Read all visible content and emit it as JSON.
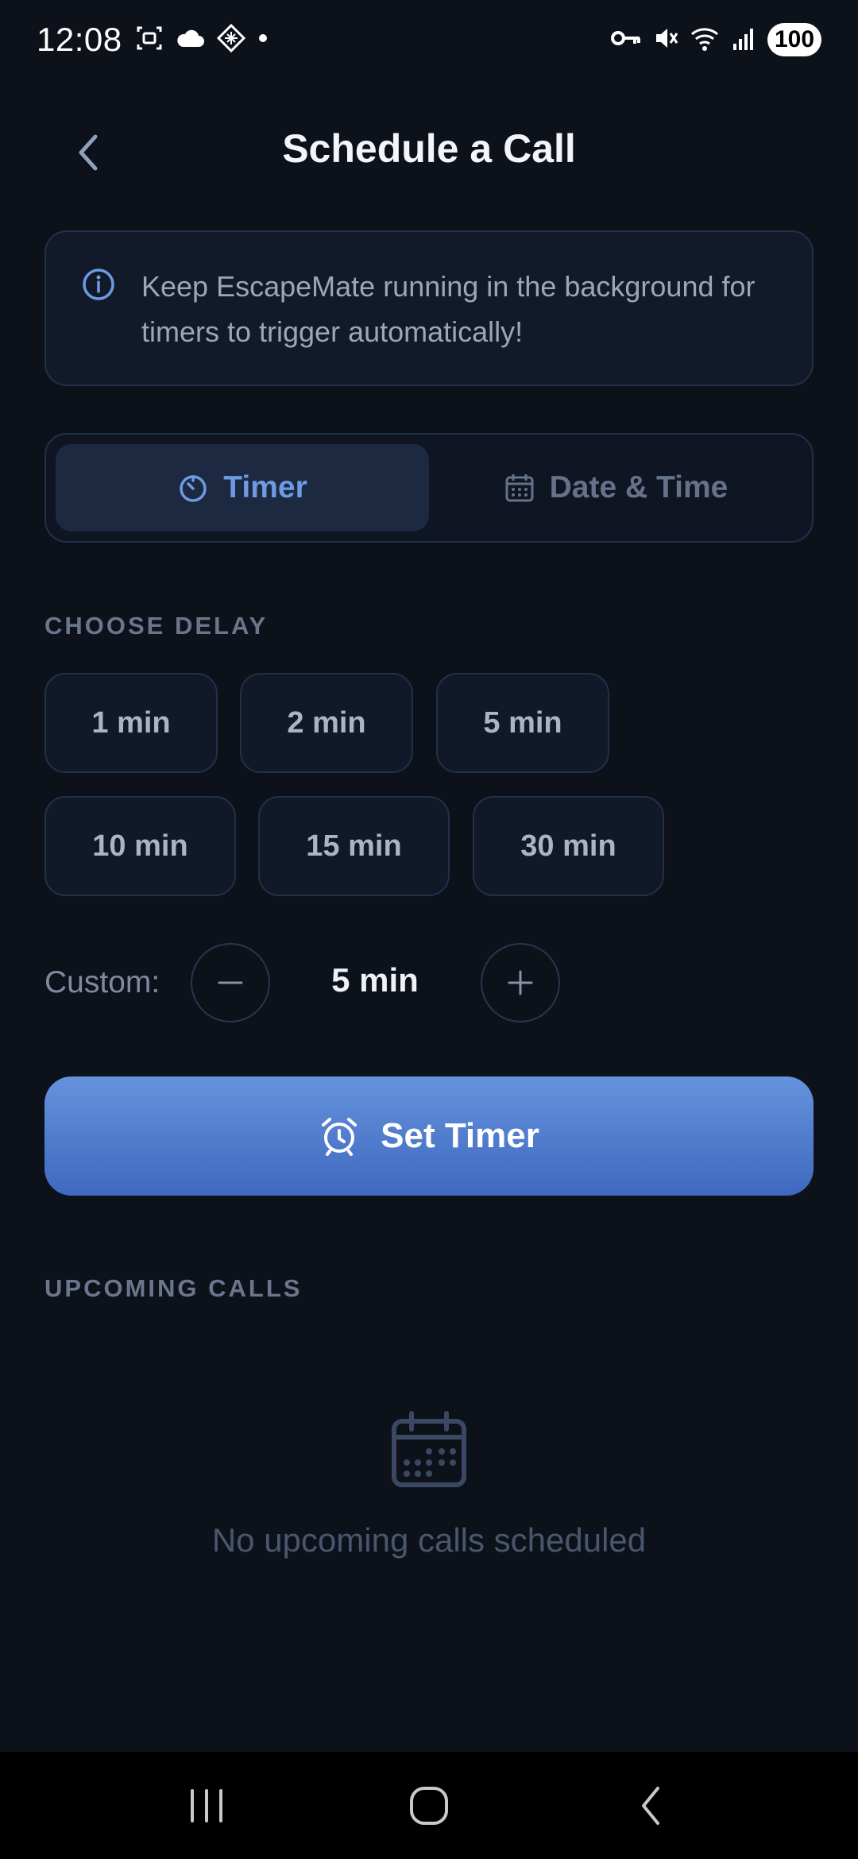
{
  "status_bar": {
    "time": "12:08",
    "battery": "100"
  },
  "header": {
    "title": "Schedule a Call"
  },
  "info": {
    "text": "Keep EscapeMate running in the background for timers to trigger automatically!"
  },
  "tabs": [
    {
      "label": "Timer",
      "icon": "timer-icon",
      "active": true
    },
    {
      "label": "Date & Time",
      "icon": "calendar-icon",
      "active": false
    }
  ],
  "choose_delay": {
    "label": "CHOOSE DELAY",
    "options": [
      "1 min",
      "2 min",
      "5 min",
      "10 min",
      "15 min",
      "30 min"
    ]
  },
  "custom": {
    "label": "Custom:",
    "value": "5 min"
  },
  "set_timer": {
    "label": "Set Timer",
    "icon": "alarm-clock-icon"
  },
  "upcoming": {
    "label": "UPCOMING CALLS",
    "empty_text": "No upcoming calls scheduled"
  },
  "colors": {
    "accent": "#6d9ae3",
    "background": "#0d111a",
    "button_top": "#6592dc",
    "button_bottom": "#3f69bf"
  }
}
